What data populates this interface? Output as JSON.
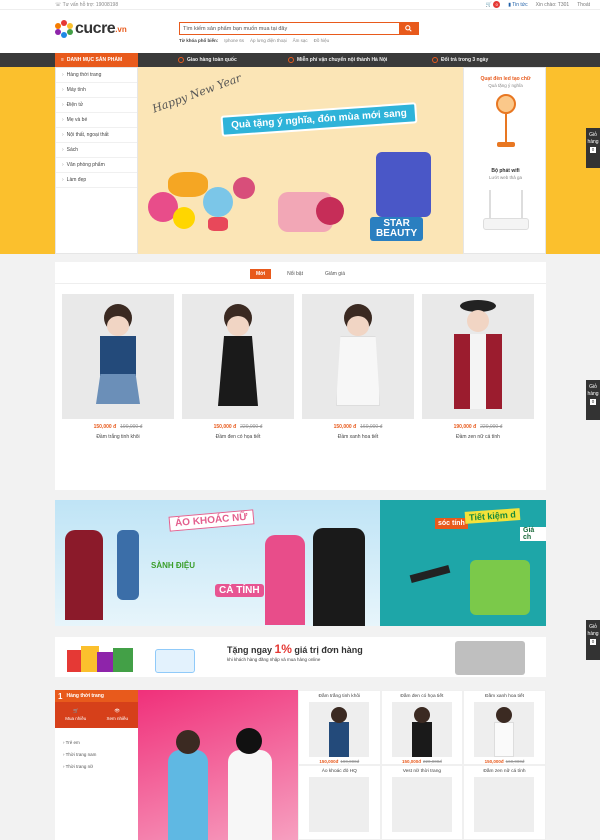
{
  "topbar": {
    "hotline": "Tư vấn hỗ trợ: 19008198",
    "cart_count": "0",
    "news": "Tin tức",
    "greeting": "Xin chào: T301",
    "logout": "Thoát"
  },
  "logo": {
    "word": "cucre",
    "tld": ".vn"
  },
  "search": {
    "placeholder": "Tìm kiếm sản phẩm bạn muốn mua tại đây",
    "kw_label": "Từ khóa phổ biến:",
    "keywords": [
      "Iphone 6s",
      "Áp lưng điện thoại",
      "Ấm sạc",
      "Đồ hiệu"
    ]
  },
  "nav": {
    "category_label": "DANH MỤC SẢN PHẨM",
    "features": [
      "Giao hàng toàn quốc",
      "Miễn phí vận chuyển nội thành Hà Nội",
      "Đổi trả trong 3 ngày"
    ]
  },
  "sidemenu": [
    "Hàng thời trang",
    "Máy tính",
    "Điện tử",
    "Mẹ và bé",
    "Nội thất, ngoại thất",
    "Sách",
    "Văn phòng phẩm",
    "Làm đẹp"
  ],
  "hero": {
    "happy": "Happy New Year",
    "slogan": "Quà tặng ý nghĩa, đón mùa mới sang",
    "star": "STAR",
    "beauty": "BEAUTY"
  },
  "sidepromo": [
    {
      "title": "Quạt đèn led tạo chữ",
      "sub": "Quà tặng ý nghĩa"
    },
    {
      "title": "Bộ phát wifi",
      "sub": "Lướt web thả ga"
    }
  ],
  "float": {
    "label": "Giỏ hàng",
    "count": "0"
  },
  "tabs": [
    "Mới",
    "Nổi bật",
    "Giảm giá"
  ],
  "products": [
    {
      "price": "150,000 đ",
      "old": "190,000 đ",
      "name": "Đầm trắng tinh khôi",
      "color": "#234a7a"
    },
    {
      "price": "150,000 đ",
      "old": "220,000 đ",
      "name": "Đầm đen có họa tiết",
      "color": "#1a1a1a"
    },
    {
      "price": "150,000 đ",
      "old": "160,000 đ",
      "name": "Đầm xanh hoa tiết",
      "color": "#f5f5f5"
    },
    {
      "price": "190,000 đ",
      "old": "220,000 đ",
      "name": "Đầm zen nữ cá tính",
      "color": "#9b1c2e"
    }
  ],
  "catbanner": {
    "title": "ÁO KHOÁC NỮ",
    "sanh": "SÀNH ĐIỆU",
    "ca": "CÁ TÍNH",
    "soc": "sóc tính",
    "tiet": "Tiết kiệm d",
    "gia": "Giá ch"
  },
  "promo": {
    "line1": "Tặng ngay",
    "pct": "1%",
    "line2": "giá trị đơn hàng",
    "sub": "khi khách hàng đăng nhập và mua hàng online"
  },
  "bottom": {
    "num": "1",
    "head": "Hàng thời trang",
    "buy_label": "Mua nhiều",
    "view_label": "Xem nhiều",
    "links": [
      "Trẻ em",
      "Thời trang nam",
      "Thời trang nữ"
    ],
    "cards": [
      {
        "name": "Đầm trắng tinh khôi",
        "price": "150,000đ",
        "old": "190,000đ",
        "color": "#234a7a"
      },
      {
        "name": "Đầm đen có họa tiết",
        "price": "150,000đ",
        "old": "220,000đ",
        "color": "#1a1a1a"
      },
      {
        "name": "Đầm xanh hoa tiết",
        "price": "150,000đ",
        "old": "160,000đ",
        "color": "#f5f5f5"
      },
      {
        "name": "Áo khoác đỏ HQ",
        "price": "",
        "old": "",
        "color": "#ffffff"
      },
      {
        "name": "Vest nữ thời trang",
        "price": "",
        "old": "",
        "color": "#ffffff"
      },
      {
        "name": "Đầm zen nữ cá tính",
        "price": "",
        "old": "",
        "color": "#ffffff"
      }
    ]
  }
}
